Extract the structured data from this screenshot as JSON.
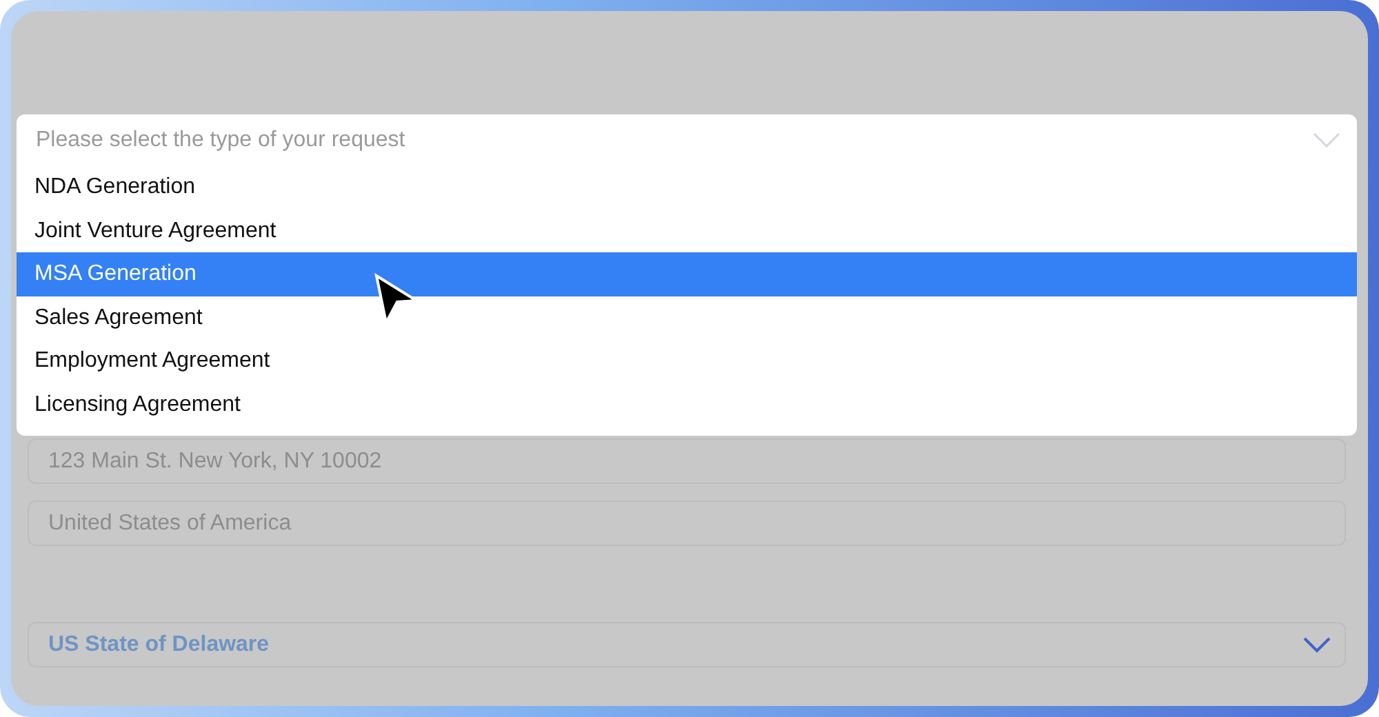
{
  "dropdown": {
    "placeholder": "Please select the type of your request",
    "options": [
      {
        "label": "NDA Generation",
        "selected": false
      },
      {
        "label": "Joint Venture Agreement",
        "selected": false
      },
      {
        "label": "MSA Generation",
        "selected": true
      },
      {
        "label": "Sales Agreement",
        "selected": false
      },
      {
        "label": "Employment Agreement",
        "selected": false
      },
      {
        "label": "Licensing Agreement",
        "selected": false
      }
    ]
  },
  "fields": [
    {
      "kind": "text",
      "placeholder": "123 Main St. New York, NY 10002"
    },
    {
      "kind": "text",
      "placeholder": "United States of America"
    },
    {
      "kind": "select",
      "value": "US State of Delaware"
    }
  ]
}
